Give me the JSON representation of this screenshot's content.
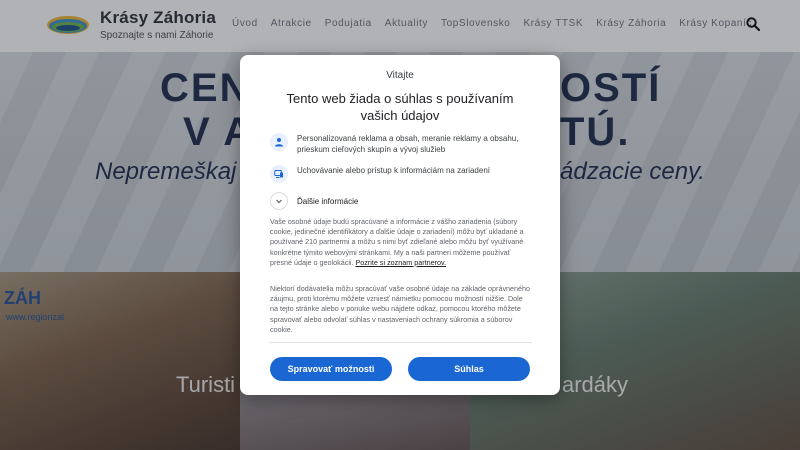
{
  "header": {
    "brand_title": "Krásy Záhoria",
    "brand_subtitle": "Spoznajte s nami Záhorie",
    "nav": [
      "Úvod",
      "Atrakcie",
      "Podujatia",
      "Aktuality",
      "TopSlovensko",
      "Krásy TTSK",
      "Krásy Záhoria",
      "Krásy Kopaníc"
    ],
    "search_icon": "search-icon"
  },
  "hero": {
    "line1_left": "CEN",
    "line1_right": "OSTÍ",
    "line2_left": "V A",
    "line2_right": "TÚ.",
    "line3_left": "Nepremeškaj",
    "line3_right": "ádzacie ceny."
  },
  "photos": {
    "caption_left": "Turisti",
    "caption_right": "ardáky",
    "sign_text": "ZÁH",
    "sign_url": "www.regionzal"
  },
  "consent": {
    "welcome": "Vitajte",
    "title": "Tento web žiada o súhlas s používaním vašich údajov",
    "purposes": [
      {
        "icon": "person-icon",
        "text": "Personalizovaná reklama a obsah, meranie reklamy a obsahu, prieskum cieľových skupín a vývoj služieb"
      },
      {
        "icon": "device-icon",
        "text": "Uchovávanie alebo prístup k informáciám na zariadení"
      },
      {
        "icon": "chevron-down-icon",
        "text": "Ďalšie informácie"
      }
    ],
    "paragraph1": "Vaše osobné údaje budú spracúvané a informácie z vášho zariadenia (súbory cookie, jedinečné identifikátory a ďalšie údaje o zariadení) môžu byť ukladané a používané 210 partnermi a môžu s nimi byť zdieľané alebo môžu byť využívané konkrétne týmito webovými stránkami. My a naši partneri môžeme používať presné údaje o geolokácii.",
    "partners_link": "Pozrite si zoznam partnerov.",
    "paragraph2": "Niektorí dodávatelia môžu spracúvať vaše osobné údaje na základe oprávneného záujmu, proti ktorému môžete vzniesť námietku pomocou možností nižšie. Dole na tejto stránke alebo v ponuke webu nájdete odkaz, pomocou ktorého môžete spravovať alebo odvolať súhlas v nastaveniach ochrany súkromia a súborov cookie.",
    "manage_button": "Spravovať možnosti",
    "accept_button": "Súhlas",
    "accent_color": "#1a66d2"
  }
}
